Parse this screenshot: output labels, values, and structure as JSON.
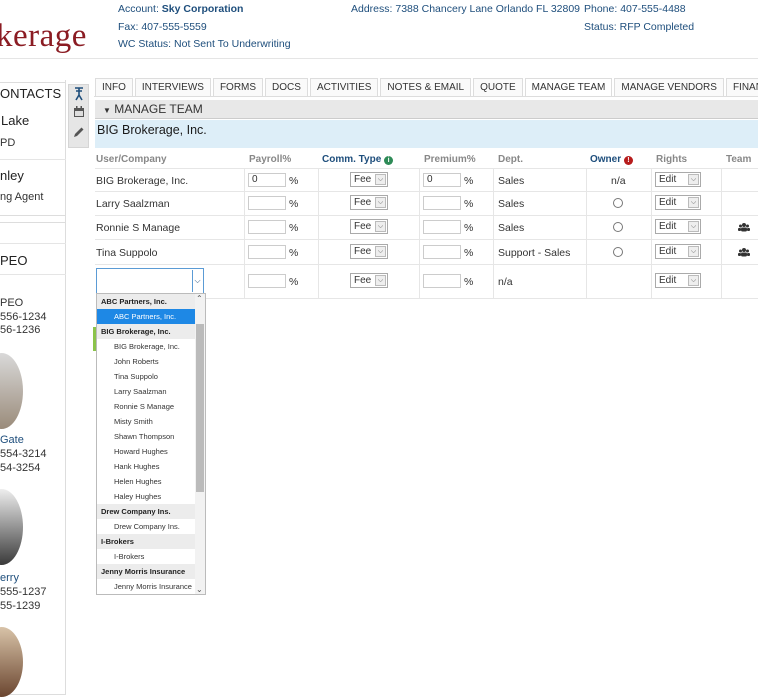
{
  "brand": {
    "logo_text": "kerage"
  },
  "header": {
    "account_label": "Account:",
    "account_value": "Sky Corporation",
    "fax_label": "Fax:",
    "fax_value": "407-555-5559",
    "wc_label": "WC Status:",
    "wc_value": "Not Sent To Underwriting",
    "address_label": "Address:",
    "address_value": "7388 Chancery Lane Orlando FL 32809",
    "phone_label": "Phone:",
    "phone_value": "407-555-4488",
    "status_label": "Status:",
    "status_value": "RFP Completed"
  },
  "left_panel": {
    "contacts_title": "ONTACTS",
    "contact1_name": "Lake",
    "contact1_sub": "PD",
    "contact2_name": "nley",
    "contact2_sub": "ng Agent",
    "peo_title": "PEO",
    "peo_line1": "PEO",
    "peo_line2": "556-1234",
    "peo_line3": "56-1236",
    "person1_name": "Gate",
    "person1_phone1": "554-3214",
    "person1_phone2": "54-3254",
    "person2_name": "erry",
    "person2_phone1": "555-1237",
    "person2_phone2": "55-1239"
  },
  "tabs": [
    "INFO",
    "INTERVIEWS",
    "FORMS",
    "DOCS",
    "ACTIVITIES",
    "NOTES & EMAIL",
    "QUOTE",
    "MANAGE TEAM",
    "MANAGE VENDORS",
    "FINANCIAL"
  ],
  "section": {
    "title": "MANAGE TEAM",
    "company": "BIG Brokerage, Inc."
  },
  "table": {
    "headers": {
      "user": "User/Company",
      "payroll": "Payroll%",
      "comm_type": "Comm. Type",
      "premium": "Premium%",
      "dept": "Dept.",
      "owner": "Owner",
      "rights": "Rights",
      "team": "Team"
    },
    "percent": "%",
    "rows": [
      {
        "user": "BIG Brokerage, Inc.",
        "payroll": "0",
        "comm": "Fee",
        "premium": "0",
        "dept": "Sales",
        "owner": "n/a",
        "rights": "Edit"
      },
      {
        "user": "Larry Saalzman",
        "payroll": "",
        "comm": "Fee",
        "premium": "",
        "dept": "Sales",
        "owner": "",
        "rights": "Edit"
      },
      {
        "user": "Ronnie S Manage",
        "payroll": "",
        "comm": "Fee",
        "premium": "",
        "dept": "Sales",
        "owner": "",
        "rights": "Edit"
      },
      {
        "user": "Tina Suppolo",
        "payroll": "",
        "comm": "Fee",
        "premium": "",
        "dept": "Support - Sales",
        "owner": "",
        "rights": "Edit"
      },
      {
        "user": "",
        "payroll": "",
        "comm": "Fee",
        "premium": "",
        "dept": "n/a",
        "owner": "",
        "rights": "Edit"
      }
    ]
  },
  "dropdown": {
    "items": [
      {
        "kind": "group",
        "label": "ABC Partners, Inc."
      },
      {
        "kind": "option",
        "label": "ABC Partners, Inc.",
        "selected": true
      },
      {
        "kind": "group",
        "label": "BIG Brokerage, Inc."
      },
      {
        "kind": "option",
        "label": "BIG Brokerage, Inc."
      },
      {
        "kind": "option",
        "label": "John Roberts"
      },
      {
        "kind": "option",
        "label": "Tina Suppolo"
      },
      {
        "kind": "option",
        "label": "Larry Saalzman"
      },
      {
        "kind": "option",
        "label": "Ronnie S Manage"
      },
      {
        "kind": "option",
        "label": "Misty Smith"
      },
      {
        "kind": "option",
        "label": "Shawn Thompson"
      },
      {
        "kind": "option",
        "label": "Howard Hughes"
      },
      {
        "kind": "option",
        "label": "Hank Hughes"
      },
      {
        "kind": "option",
        "label": "Helen Hughes"
      },
      {
        "kind": "option",
        "label": "Haley Hughes"
      },
      {
        "kind": "group",
        "label": "Drew Company Ins."
      },
      {
        "kind": "option",
        "label": "Drew Company Ins."
      },
      {
        "kind": "group",
        "label": "I-Brokers"
      },
      {
        "kind": "option",
        "label": "I-Brokers"
      },
      {
        "kind": "group",
        "label": "Jenny Morris Insurance"
      },
      {
        "kind": "option",
        "label": "Jenny Morris Insurance"
      }
    ]
  },
  "colors": {
    "brand": "#8b1c23",
    "link": "#1e4e7c",
    "selected": "#1e88e5",
    "owner_icon": "#b71c1c",
    "info_icon": "#2e8b57"
  }
}
